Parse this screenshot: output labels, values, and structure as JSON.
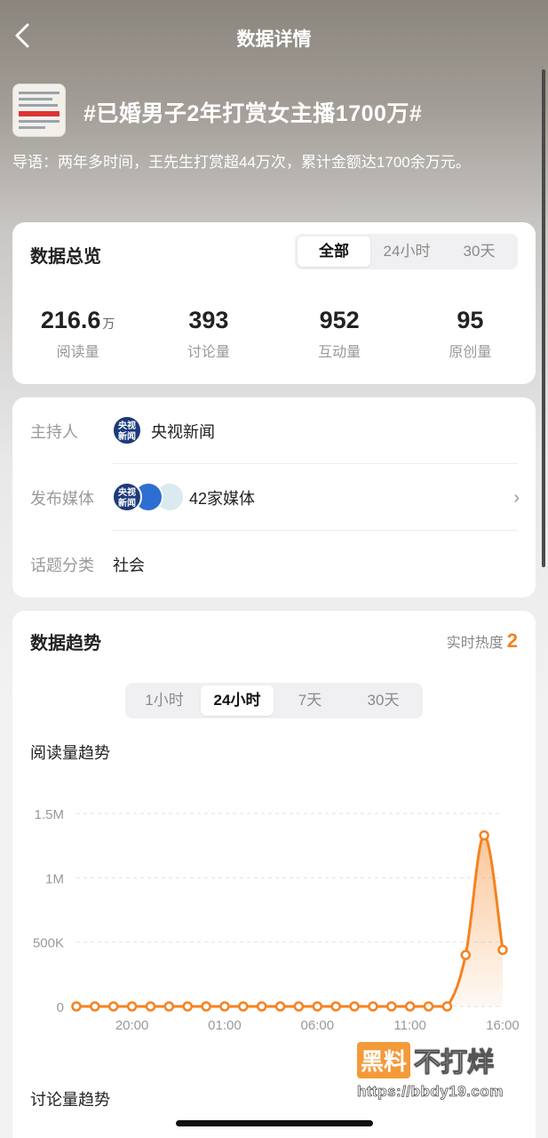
{
  "nav": {
    "title": "数据详情"
  },
  "topic": {
    "title": "#已婚男子2年打赏女主播1700万#",
    "intro": "导语：两年多时间，王先生打赏超44万次，累计金额达1700余万元。"
  },
  "overview": {
    "title": "数据总览",
    "tabs": [
      "全部",
      "24小时",
      "30天"
    ],
    "active_tab": "全部",
    "stats": [
      {
        "value": "216.6",
        "unit": "万",
        "label": "阅读量"
      },
      {
        "value": "393",
        "unit": "",
        "label": "讨论量"
      },
      {
        "value": "952",
        "unit": "",
        "label": "互动量"
      },
      {
        "value": "95",
        "unit": "",
        "label": "原创量"
      }
    ]
  },
  "info": {
    "host_label": "主持人",
    "host_value": "央视新闻",
    "host_logo_text": [
      "央视",
      "新闻"
    ],
    "media_label": "发布媒体",
    "media_value": "42家媒体",
    "category_label": "话题分类",
    "category_value": "社会"
  },
  "trend": {
    "title": "数据趋势",
    "heat_label": "实时热度",
    "heat_value": "2",
    "tabs": [
      "1小时",
      "24小时",
      "7天",
      "30天"
    ],
    "active_tab": "24小时",
    "read_trend_title": "阅读量趋势",
    "discussion_trend_title": "讨论量趋势"
  },
  "chart_data": {
    "type": "line",
    "title": "阅读量趋势",
    "xlabel": "",
    "ylabel": "",
    "x": [
      "17:00",
      "18:00",
      "19:00",
      "20:00",
      "21:00",
      "22:00",
      "23:00",
      "00:00",
      "01:00",
      "02:00",
      "03:00",
      "04:00",
      "05:00",
      "06:00",
      "07:00",
      "08:00",
      "09:00",
      "10:00",
      "11:00",
      "12:00",
      "13:00",
      "14:00",
      "15:00",
      "16:00"
    ],
    "x_tick_labels": [
      "20:00",
      "01:00",
      "06:00",
      "11:00",
      "16:00"
    ],
    "y_tick_labels": [
      "0",
      "500K",
      "1M",
      "1.5M"
    ],
    "ylim": [
      0,
      1500000
    ],
    "series": [
      {
        "values": [
          0,
          0,
          0,
          0,
          0,
          0,
          0,
          0,
          0,
          0,
          0,
          0,
          0,
          0,
          0,
          0,
          0,
          0,
          0,
          0,
          0,
          400000,
          1330000,
          440000
        ],
        "color": "#f5821f"
      }
    ],
    "grid": true
  },
  "watermark": {
    "brand_box": "黑料",
    "brand_rest": "不打烊",
    "url": "https://bbdy19.com"
  }
}
